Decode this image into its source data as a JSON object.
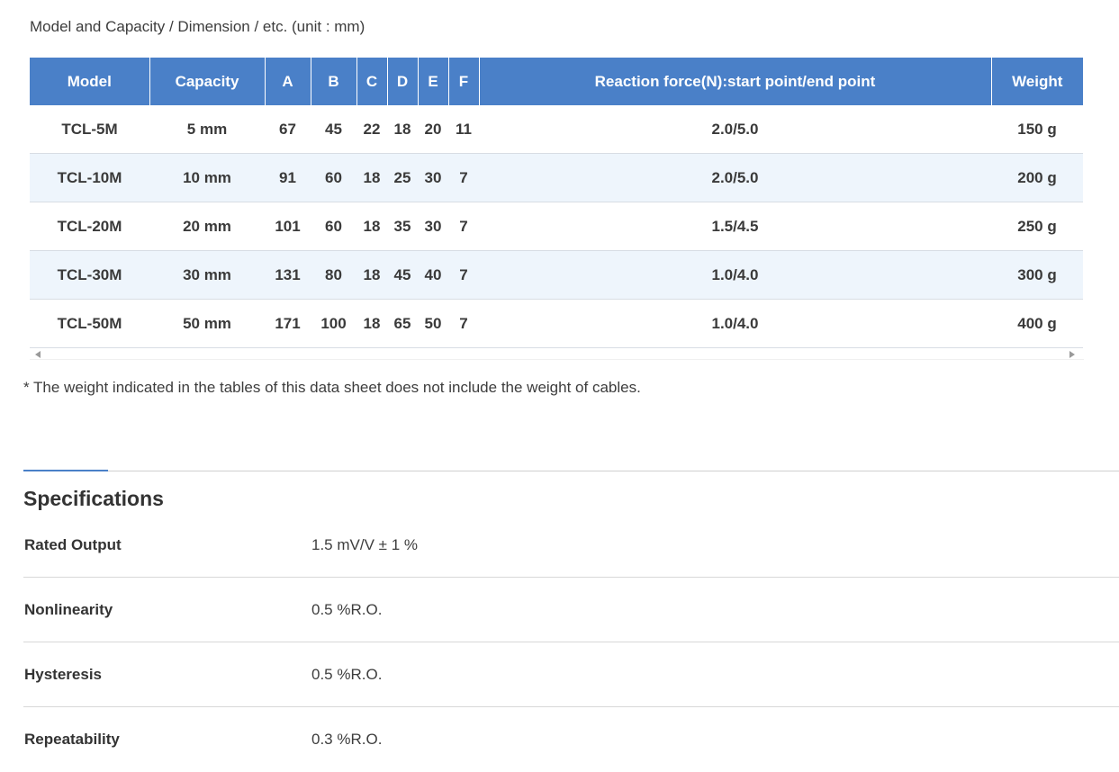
{
  "caption": "Model and Capacity / Dimension / etc. (unit : mm)",
  "table": {
    "headers": [
      "Model",
      "Capacity",
      "A",
      "B",
      "C",
      "D",
      "E",
      "F",
      "Reaction force(N):start point/end point",
      "Weight"
    ],
    "rows": [
      [
        "TCL-5M",
        "5 mm",
        "67",
        "45",
        "22",
        "18",
        "20",
        "11",
        "2.0/5.0",
        "150 g"
      ],
      [
        "TCL-10M",
        "10 mm",
        "91",
        "60",
        "18",
        "25",
        "30",
        "7",
        "2.0/5.0",
        "200 g"
      ],
      [
        "TCL-20M",
        "20 mm",
        "101",
        "60",
        "18",
        "35",
        "30",
        "7",
        "1.5/4.5",
        "250 g"
      ],
      [
        "TCL-30M",
        "30 mm",
        "131",
        "80",
        "18",
        "45",
        "40",
        "7",
        "1.0/4.0",
        "300 g"
      ],
      [
        "TCL-50M",
        "50 mm",
        "171",
        "100",
        "18",
        "65",
        "50",
        "7",
        "1.0/4.0",
        "400 g"
      ]
    ]
  },
  "note": "* The weight indicated in the tables of this data sheet does not include the weight of cables.",
  "specifications": {
    "title": "Specifications",
    "items": [
      {
        "label": "Rated Output",
        "value": "1.5 mV/V ± 1 %"
      },
      {
        "label": "Nonlinearity",
        "value": "0.5 %R.O."
      },
      {
        "label": "Hysteresis",
        "value": "0.5 %R.O."
      },
      {
        "label": "Repeatability",
        "value": "0.3 %R.O."
      }
    ]
  },
  "colors": {
    "header_bg": "#4a80c8",
    "stripe_bg": "#eef5fc",
    "accent": "#4a80c8"
  }
}
